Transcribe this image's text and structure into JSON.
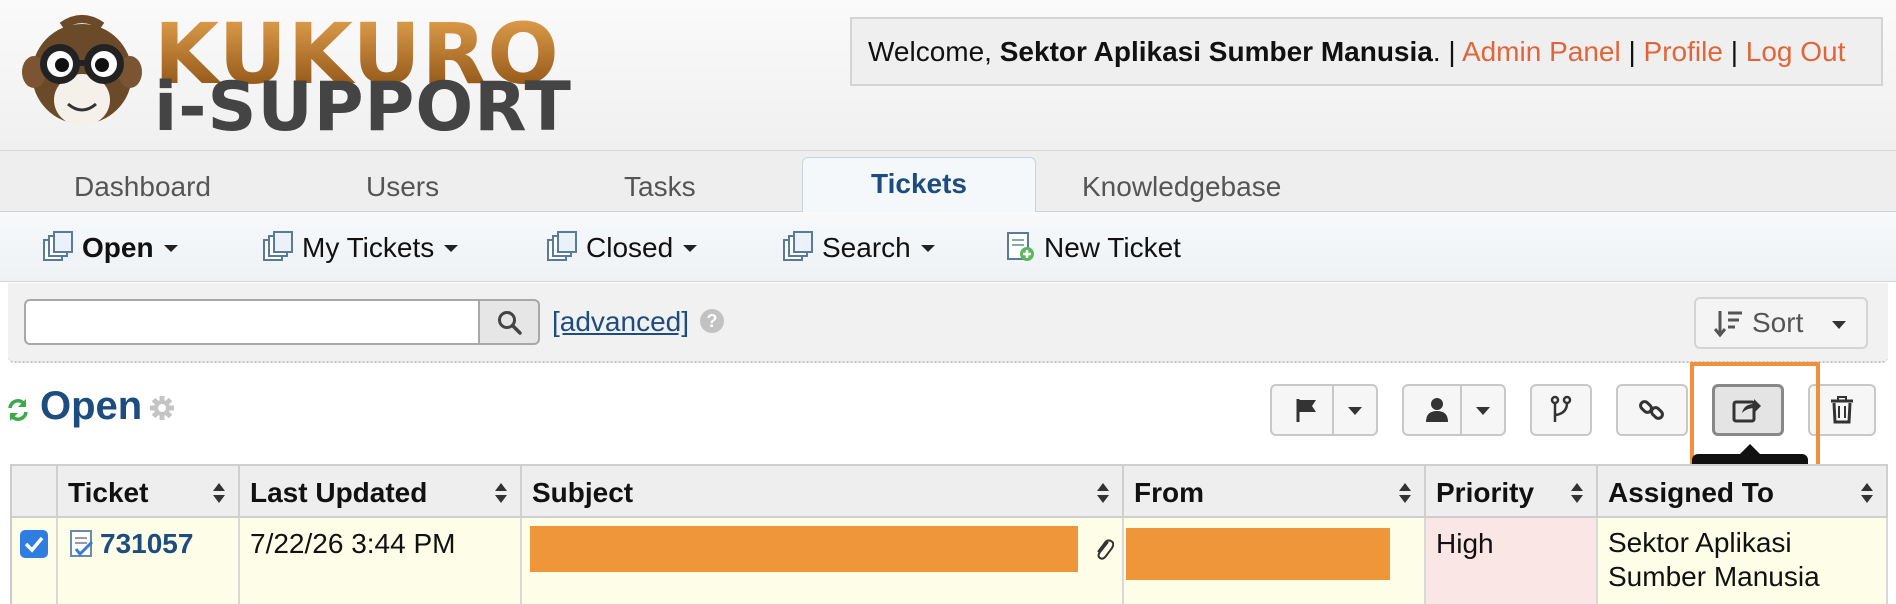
{
  "brand": {
    "logo_line1": "KUKURO",
    "logo_line2": "i-SUPPORT",
    "colors": {
      "brand_orange": "#c67a26",
      "link": "#e0663a",
      "accent_blue": "#1d4c7f"
    }
  },
  "header": {
    "welcome_prefix": "Welcome,",
    "user_name": "Sektor Aplikasi Sumber Manusia",
    "after_name": ". |",
    "admin_panel": "Admin Panel",
    "sep1": "|",
    "profile": "Profile",
    "sep2": "|",
    "logout": "Log Out"
  },
  "nav": {
    "tabs": [
      {
        "label": "Dashboard",
        "active": false
      },
      {
        "label": "Users",
        "active": false
      },
      {
        "label": "Tasks",
        "active": false
      },
      {
        "label": "Tickets",
        "active": true
      },
      {
        "label": "Knowledgebase",
        "active": false
      }
    ]
  },
  "subnav": {
    "items": [
      {
        "label": "Open",
        "icon": "tickets-icon",
        "dropdown": true,
        "bold": true
      },
      {
        "label": "My Tickets",
        "icon": "tickets-icon",
        "dropdown": true
      },
      {
        "label": "Closed",
        "icon": "tickets-icon",
        "dropdown": true
      },
      {
        "label": "Search",
        "icon": "tickets-icon",
        "dropdown": true
      },
      {
        "label": "New Ticket",
        "icon": "new-ticket-icon",
        "dropdown": false
      }
    ]
  },
  "search": {
    "value": "",
    "advanced_label": "[advanced]",
    "help": "?",
    "sort_label": "Sort"
  },
  "queue": {
    "title": "Open",
    "toolbar": {
      "tooltip": "Transfer"
    }
  },
  "table": {
    "columns": [
      "Ticket",
      "Last Updated",
      "Subject",
      "From",
      "Priority",
      "Assigned To"
    ],
    "rows": [
      {
        "checked": true,
        "ticket": "731057",
        "last_updated": "7/22/26 3:44 PM",
        "subject": "",
        "from": "",
        "priority": "High",
        "assigned_to": "Sektor Aplikasi Sumber Manusia"
      }
    ]
  }
}
